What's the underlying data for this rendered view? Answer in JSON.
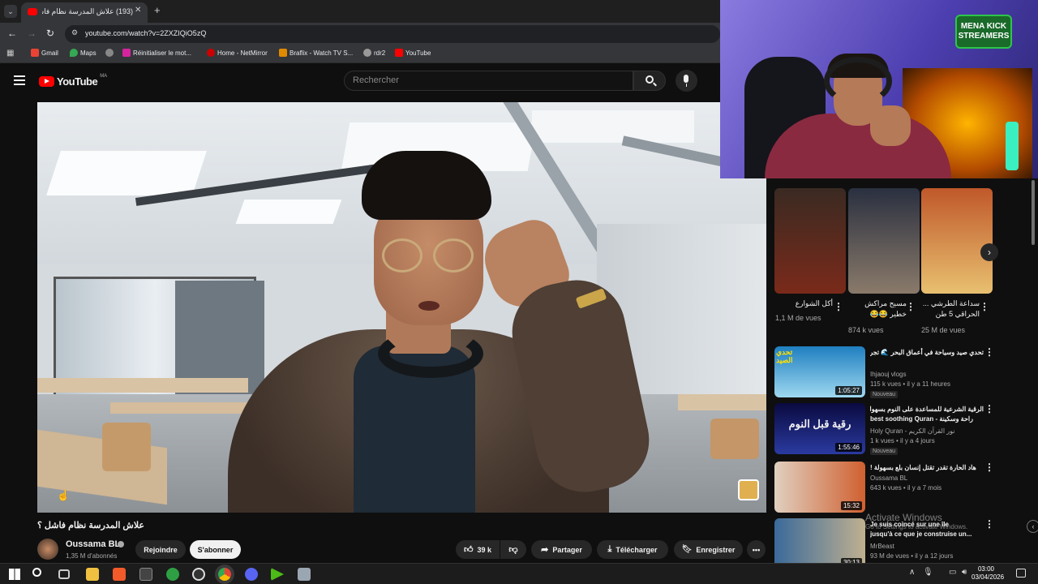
{
  "browser": {
    "tab_title": "(193) علاش المدرسة نظام فاشل",
    "url": "youtube.com/watch?v=2ZXZIQiO5zQ",
    "bookmarks": [
      "Gmail",
      "Maps",
      "Réinitialiser le mot...",
      "Home - NetMirror",
      "Braflix - Watch TV S...",
      "rdr2",
      "YouTube"
    ]
  },
  "youtube": {
    "logo_text": "YouTube",
    "region": "MA",
    "search_placeholder": "Rechercher"
  },
  "video": {
    "title": "علاش المدرسة نظام فاشل ؟",
    "channel": "Oussama BL",
    "subscribers": "1,35 M d'abonnés",
    "join_label": "Rejoindre",
    "subscribe_label": "S'abonner",
    "likes": "39 k",
    "share_label": "Partager",
    "download_label": "Télécharger",
    "save_label": "Enregistrer"
  },
  "webcam": {
    "badge_line1": "MENA KICK",
    "badge_line2": "STREAMERS"
  },
  "shorts": [
    {
      "title": "أكل الشوارع",
      "views": "1,1 M de vues",
      "color1": "#3a2a22",
      "color2": "#7a2a1a"
    },
    {
      "title": "مسيح مراكش خطير 😂😂",
      "views": "874 k vues",
      "color1": "#5a4a3a",
      "color2": "#8a7a6a"
    },
    {
      "title": "سداعة الطرشي ... الحراقي 5 طن",
      "views": "25 M de vues",
      "color1": "#c0582a",
      "color2": "#e8c070"
    }
  ],
  "recommendations": [
    {
      "title": "تحدي صيد وسياحة في أعماق البحر 🌊 تجربة لا تنسى لحظات مجنونة | شوفو شنو",
      "channel": "Ihjaouj vlogs",
      "meta": "115 k vues • il y a 11 heures",
      "badge": "Nouveau",
      "duration": "1:05:27",
      "thumb_text": "تحدي الصيد",
      "c1": "#1f7fc0",
      "c2": "#9ed8f0"
    },
    {
      "title": "الرقية الشرعية للمساعدة على النوم بسهولة",
      "title2": "best soothing Quran - راحة وسكينة",
      "channel": "Holy Quran - نور القرآن الكريم",
      "meta": "1 k vues • il y a 4 jours",
      "badge": "Nouveau",
      "duration": "1:55:46",
      "thumb_text": "رقية قبل النوم",
      "c1": "#0a0a40",
      "c2": "#2a3aa0"
    },
    {
      "title": "هاد الحارة تقدر تقتل إنسان بلع بسهولة !",
      "channel": "Oussama BL",
      "meta": "643 k vues • il y a 7 mois",
      "badge": "",
      "duration": "15:32",
      "thumb_text": "",
      "c1": "#e0d0c0",
      "c2": "#d06030"
    },
    {
      "title": "Je suis coincé sur une île",
      "title2": "jusqu'à ce que je construise un...",
      "channel": "MrBeast",
      "meta": "93 M de vues • il y a 12 jours",
      "badge": "",
      "duration": "30:13",
      "thumb_text": "",
      "c1": "#3a6a9a",
      "c2": "#c0b090"
    }
  ],
  "watermark": {
    "line1": "Activate Windows",
    "line2": "Go to Settings to activate Windows."
  },
  "taskbar": {
    "time": "03:00",
    "date": "03/04/2026"
  }
}
